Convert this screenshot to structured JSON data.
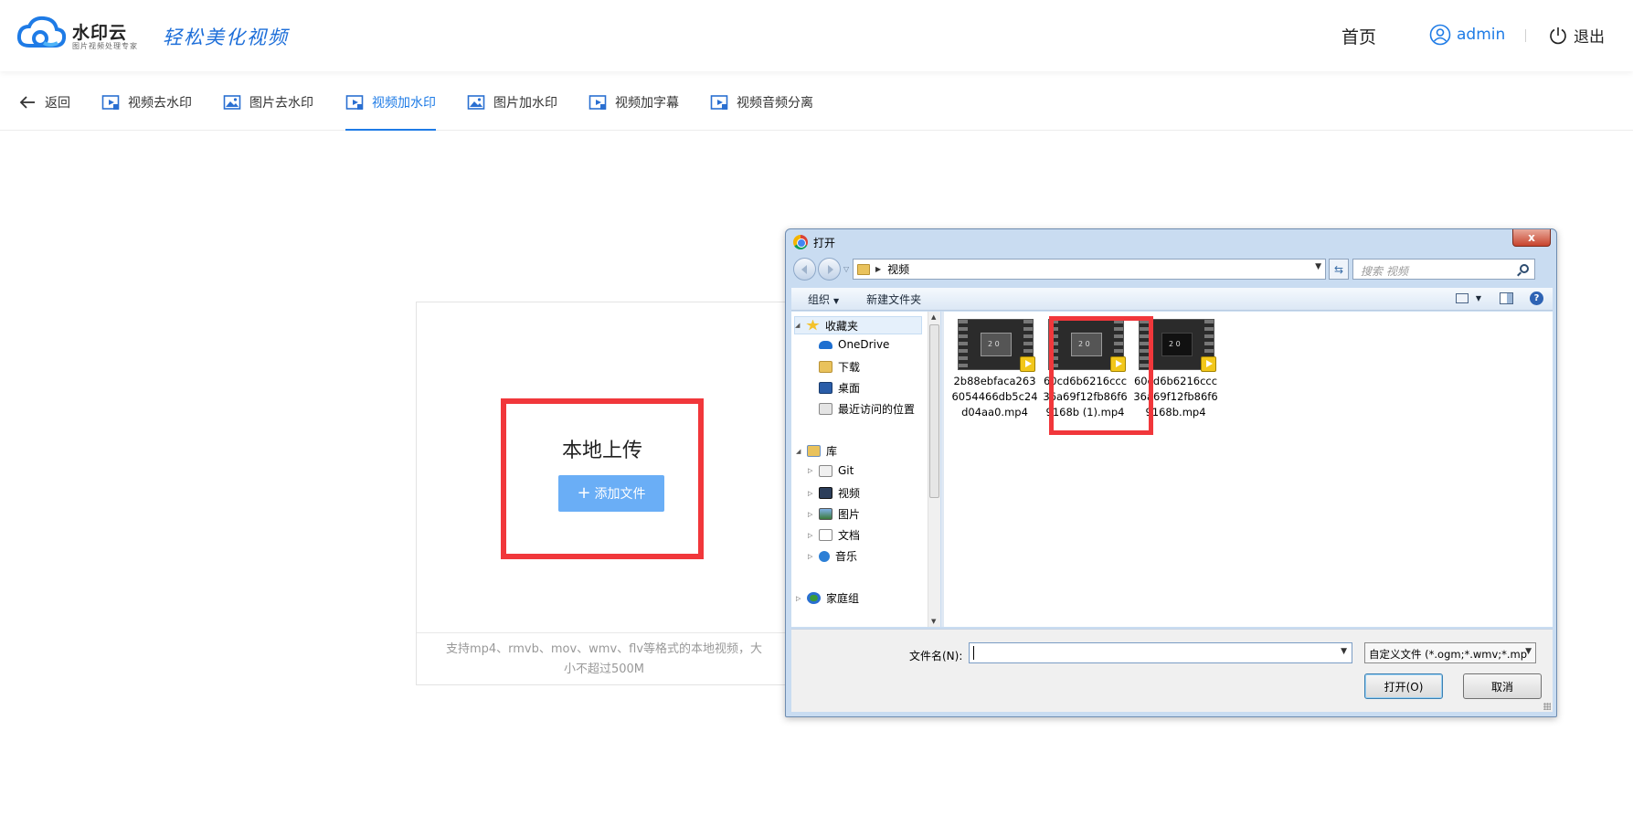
{
  "header": {
    "brand_name": "水印云",
    "brand_sub": "图片视频处理专家",
    "slogan": "轻松美化视频",
    "nav_home": "首页",
    "user_name": "admin",
    "logout": "退出",
    "accent_color": "#1e7be6"
  },
  "tabs": [
    {
      "label": "返回",
      "icon": "arrow-left-icon"
    },
    {
      "label": "视频去水印",
      "icon": "video-icon"
    },
    {
      "label": "图片去水印",
      "icon": "image-icon"
    },
    {
      "label": "视频加水印",
      "icon": "video-icon",
      "active": true
    },
    {
      "label": "图片加水印",
      "icon": "image-icon"
    },
    {
      "label": "视频加字幕",
      "icon": "video-icon"
    },
    {
      "label": "视频音频分离",
      "icon": "video-icon"
    }
  ],
  "upload": {
    "title": "本地上传",
    "add_button": "添加文件",
    "hint": "支持mp4、rmvb、mov、wmv、flv等格式的本地视频，大小不超过500M"
  },
  "dialog": {
    "title": "打开",
    "close": "x",
    "breadcrumb": "视频",
    "search_placeholder": "搜索 视频",
    "toolbar": {
      "organize": "组织",
      "new_folder": "新建文件夹",
      "help": "?"
    },
    "nav": {
      "favorites": "收藏夹",
      "onedrive": "OneDrive",
      "downloads": "下载",
      "desktop": "桌面",
      "recent": "最近访问的位置",
      "libraries": "库",
      "git": "Git",
      "videos": "视频",
      "pictures": "图片",
      "documents": "文档",
      "music": "音乐",
      "homegroup": "家庭组"
    },
    "files": [
      {
        "name": "2b88ebfaca2636054466db5c24d04aa0.mp4"
      },
      {
        "name": "60cd6b6216ccc36a69f12fb86f69168b (1).mp4",
        "highlighted": true
      },
      {
        "name": "60cd6b6216ccc36a69f12fb86f69168b.mp4"
      }
    ],
    "filename_label": "文件名(N):",
    "filename_value": "",
    "filetype_value": "自定义文件 (*.ogm;*.wmv;*.mp",
    "open_button": "打开(O)",
    "cancel_button": "取消"
  },
  "highlight_color": "#f1373b"
}
